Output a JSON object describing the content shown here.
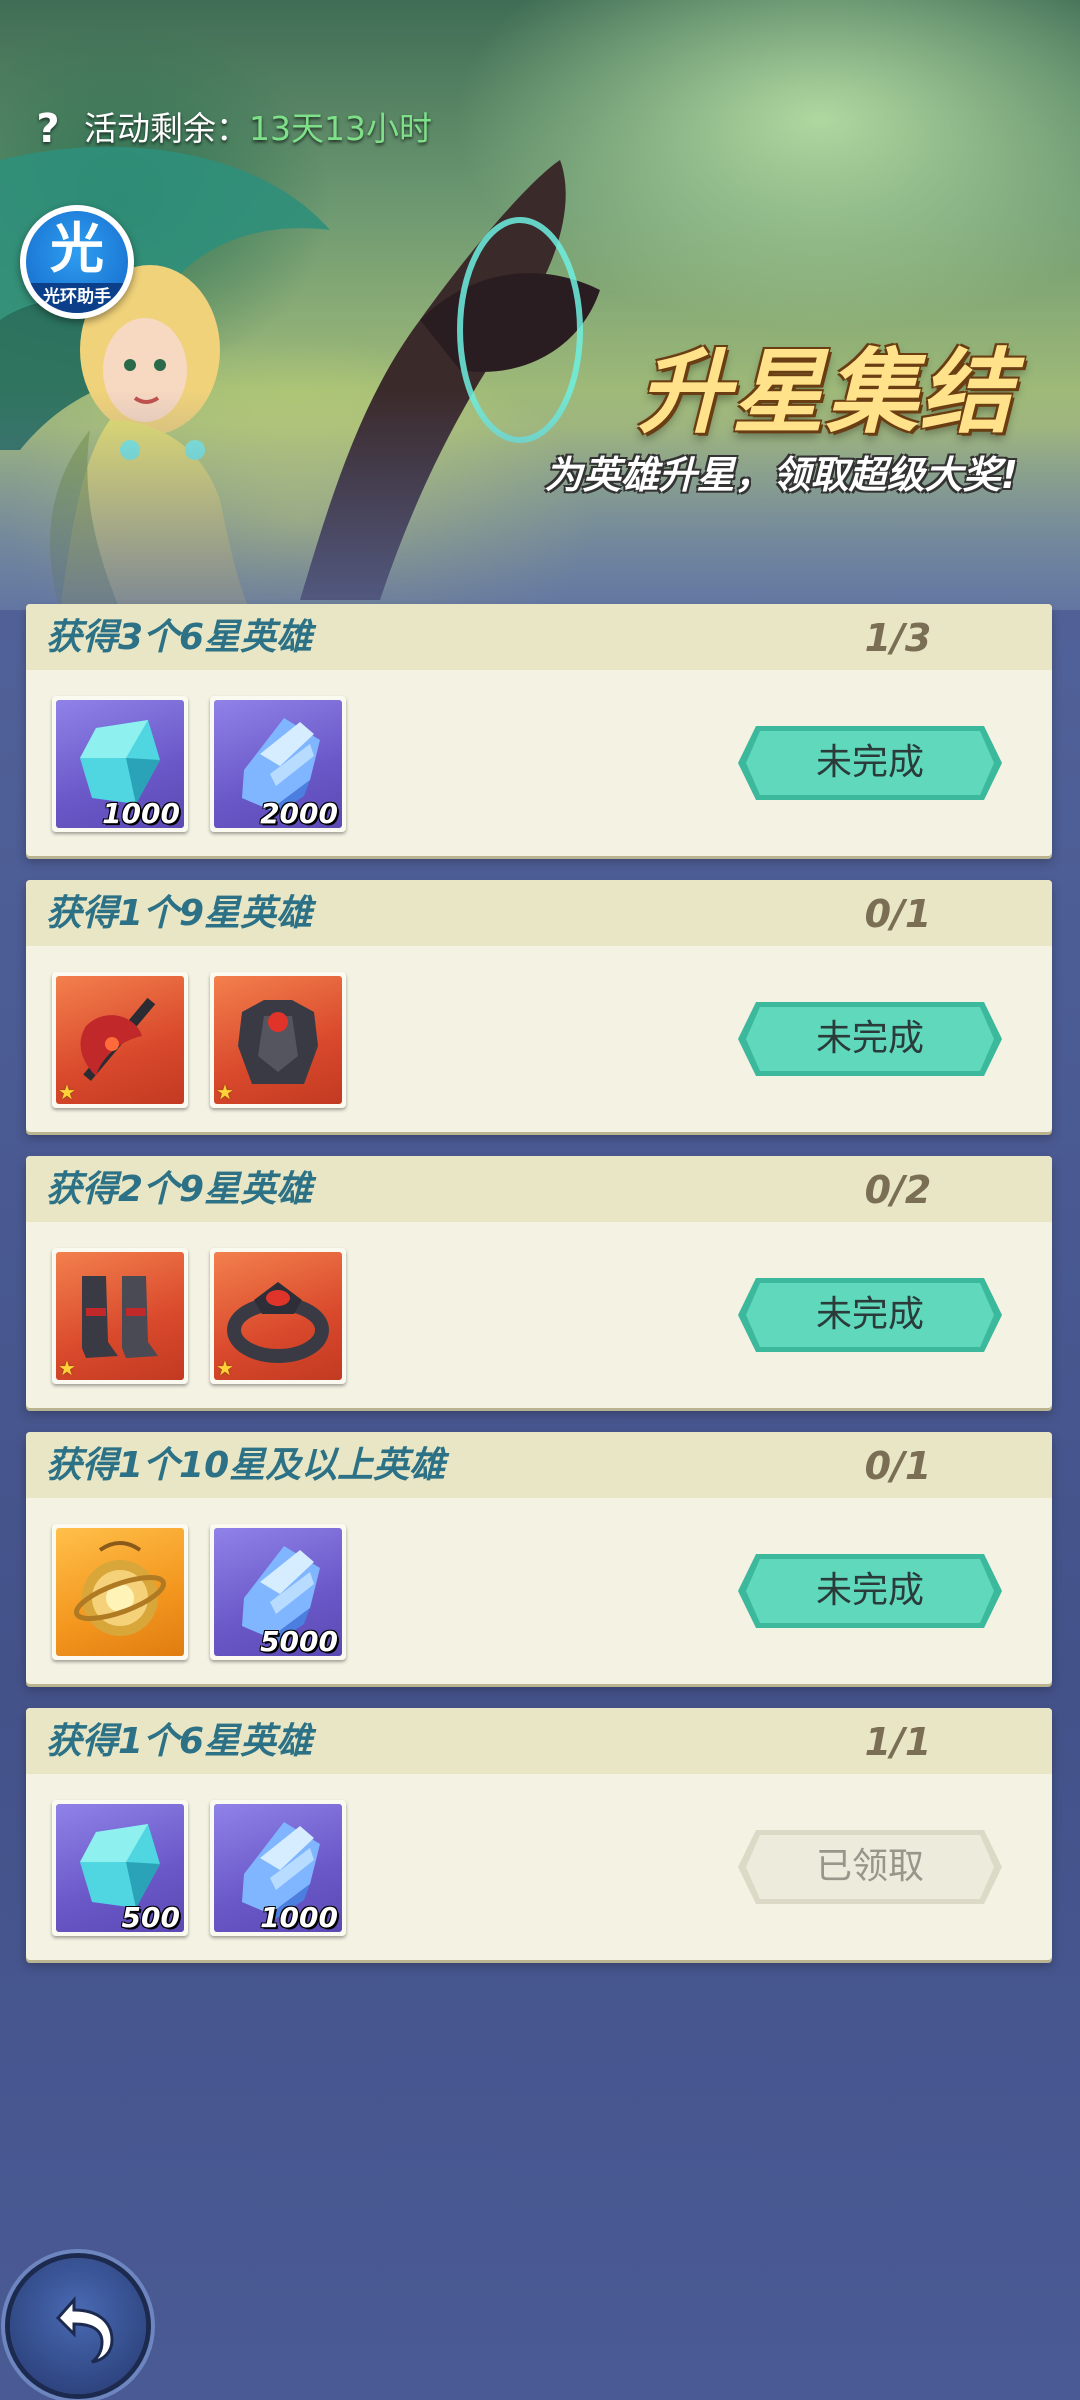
{
  "header": {
    "help_icon": "question-mark-icon",
    "timer_label": "活动剩余：",
    "timer_value": "13天13小时",
    "assistant": {
      "glyph": "光",
      "label": "光环助手"
    }
  },
  "banner": {
    "title": "升星集结",
    "subtitle": "为英雄升星，领取超级大奖!"
  },
  "tasks": [
    {
      "title": "获得3个6星英雄",
      "progress": "1/3",
      "status": "未完成",
      "rewards": [
        {
          "icon": "teal-crystal-icon",
          "bg": "purple",
          "qty": "1000"
        },
        {
          "icon": "blue-crystal-icon",
          "bg": "purple",
          "qty": "2000"
        }
      ]
    },
    {
      "title": "获得1个9星英雄",
      "progress": "0/1",
      "status": "未完成",
      "rewards": [
        {
          "icon": "red-axe-icon",
          "bg": "red",
          "qty": ""
        },
        {
          "icon": "dark-armor-icon",
          "bg": "red",
          "qty": ""
        }
      ]
    },
    {
      "title": "获得2个9星英雄",
      "progress": "0/2",
      "status": "未完成",
      "rewards": [
        {
          "icon": "dark-boots-icon",
          "bg": "red",
          "qty": ""
        },
        {
          "icon": "dark-ring-icon",
          "bg": "red",
          "qty": ""
        }
      ]
    },
    {
      "title": "获得1个10星及以上英雄",
      "progress": "0/1",
      "status": "未完成",
      "rewards": [
        {
          "icon": "golden-amulet-icon",
          "bg": "gold",
          "qty": ""
        },
        {
          "icon": "blue-crystal-icon",
          "bg": "purple",
          "qty": "5000"
        }
      ]
    },
    {
      "title": "获得1个6星英雄",
      "progress": "1/1",
      "status": "已领取",
      "rewards": [
        {
          "icon": "teal-crystal-icon",
          "bg": "purple",
          "qty": "500"
        },
        {
          "icon": "blue-crystal-icon",
          "bg": "purple",
          "qty": "1000"
        }
      ]
    }
  ],
  "colors": {
    "status_incomplete": "#4fcfb0",
    "status_claimed": "#ecebdc",
    "title_text": "#2c7186",
    "timer_value": "#7fe08a"
  },
  "footer": {
    "back_icon": "back-arrow-icon"
  }
}
